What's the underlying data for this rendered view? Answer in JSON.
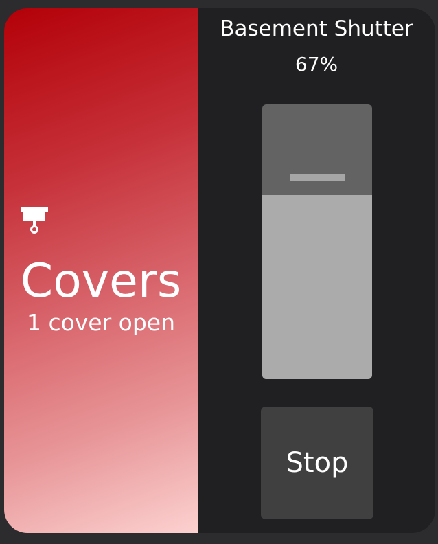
{
  "category": {
    "icon": "window-shutter-icon",
    "title": "Covers",
    "status": "1 cover open",
    "gradient_colors": [
      "#b30008",
      "#fcd1d0"
    ]
  },
  "device": {
    "name": "Basement Shutter",
    "value_label": "67%",
    "position_fraction": 0.67
  },
  "controls": {
    "stop_label": "Stop"
  },
  "colors": {
    "background": "#2c2c2e",
    "panel": "#202022",
    "slider_track": "#636363",
    "slider_fill": "#ababab",
    "button": "#404040"
  }
}
